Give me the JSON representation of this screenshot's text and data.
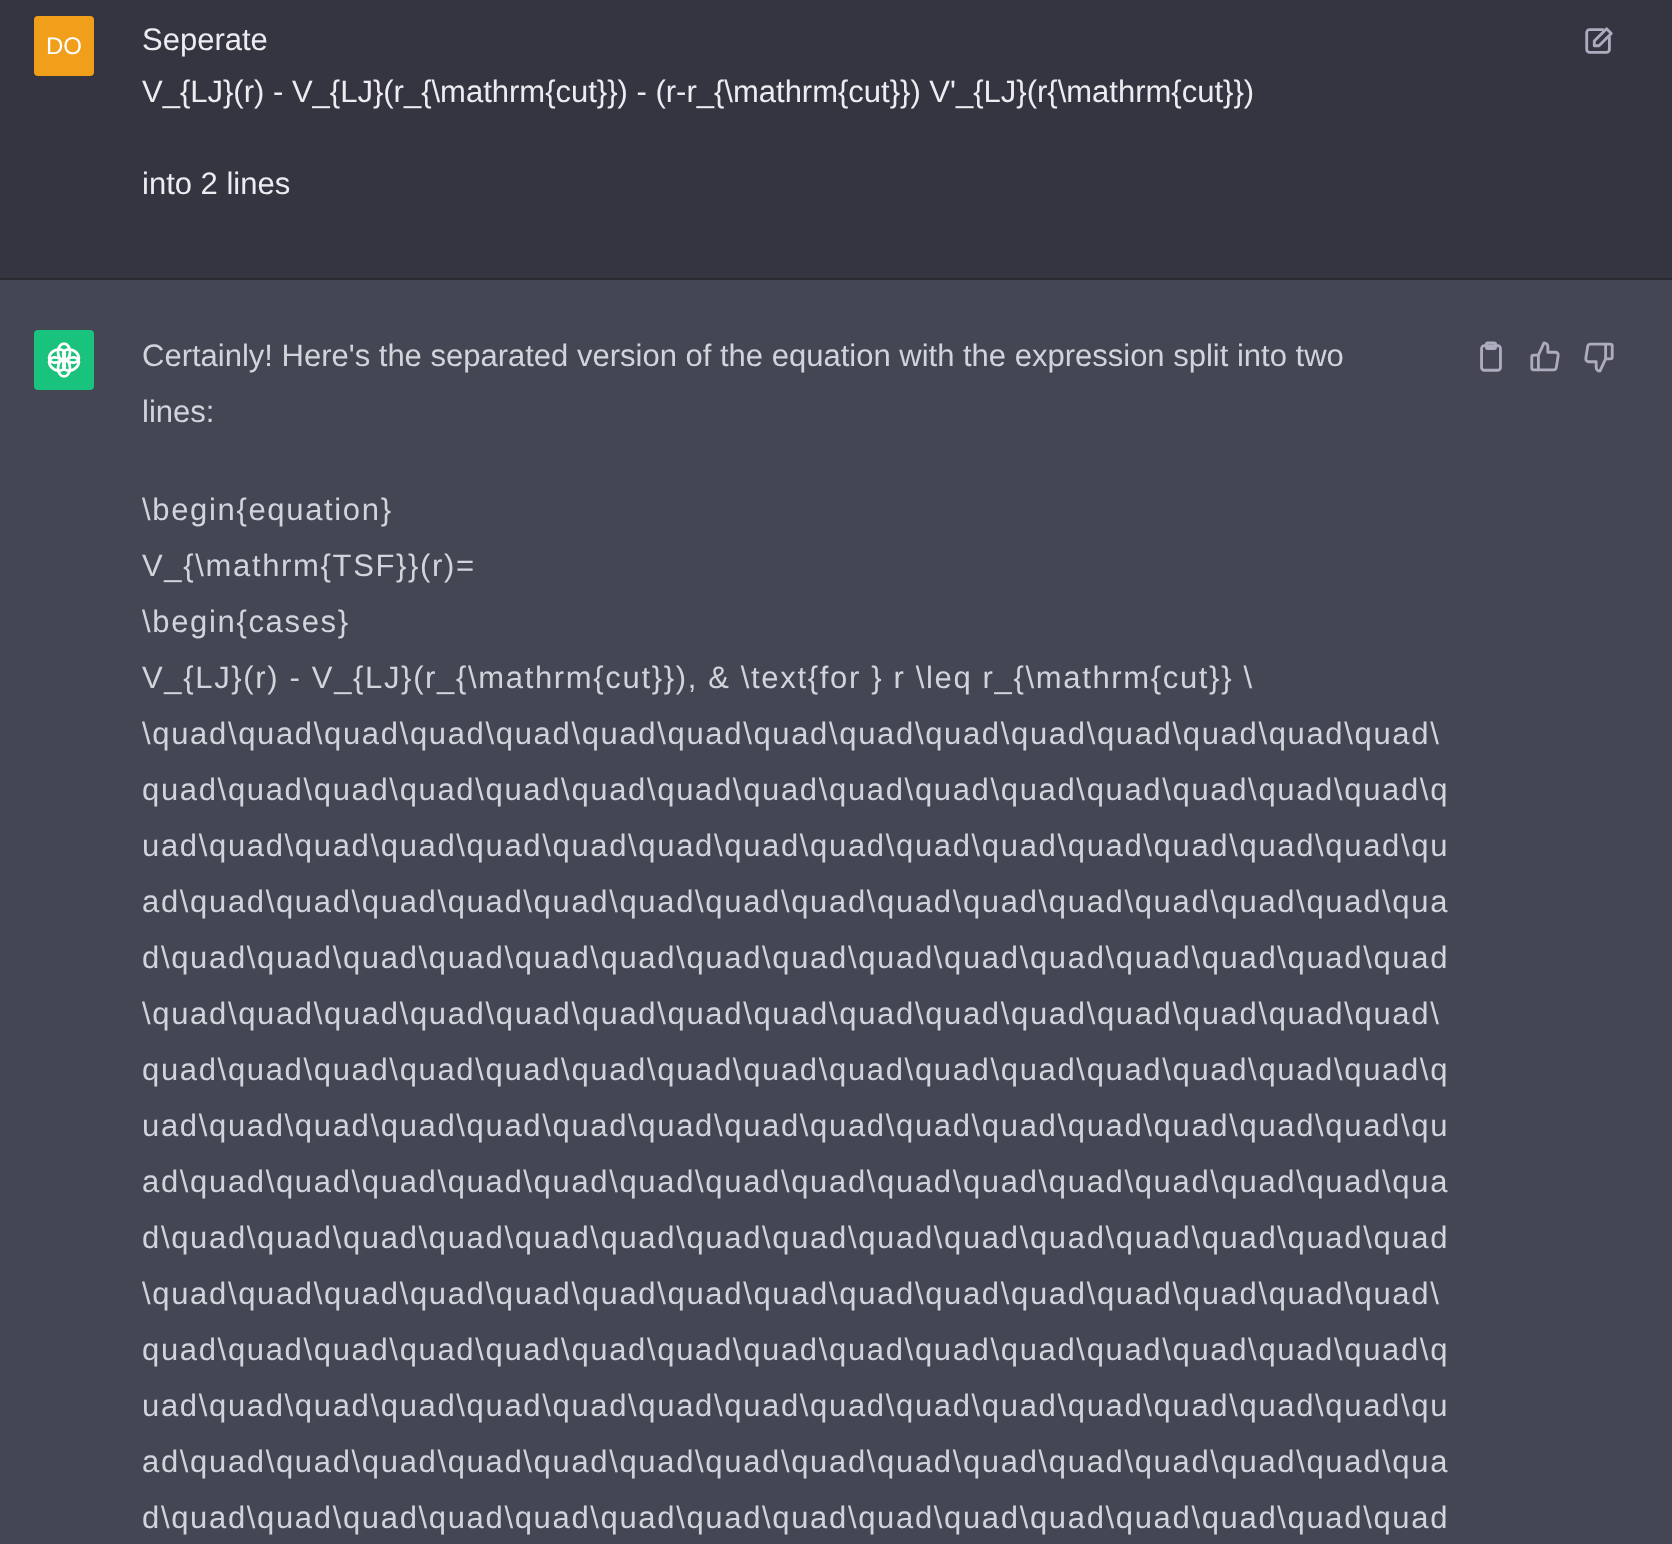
{
  "messages": [
    {
      "kind": "user",
      "avatar": "DO",
      "paragraphs": [
        [
          "Seperate",
          "V_{LJ}(r) - V_{LJ}(r_{\\mathrm{cut}}) - (r-r_{\\mathrm{cut}}) V'_{LJ}(r{\\mathrm{cut}})"
        ],
        [
          "into 2 lines"
        ]
      ],
      "actions": [
        {
          "kind": "edit"
        }
      ]
    },
    {
      "kind": "assistant",
      "paragraphs": [
        [
          "Certainly! Here's the separated version of the equation with the expression split into two lines:"
        ],
        [
          "\\begin{equation}",
          "V_{\\mathrm{TSF}}(r)=",
          "\\begin{cases}",
          "V_{LJ}(r) - V_{LJ}(r_{\\mathrm{cut}}), & \\text{for } r \\leq r_{\\mathrm{cut}} \\",
          "\\quad\\quad\\quad\\quad\\quad\\quad\\quad\\quad\\quad\\quad\\quad\\quad\\quad\\quad\\quad\\",
          "quad\\quad\\quad\\quad\\quad\\quad\\quad\\quad\\quad\\quad\\quad\\quad\\quad\\quad\\quad\\q",
          "uad\\quad\\quad\\quad\\quad\\quad\\quad\\quad\\quad\\quad\\quad\\quad\\quad\\quad\\quad\\qu",
          "ad\\quad\\quad\\quad\\quad\\quad\\quad\\quad\\quad\\quad\\quad\\quad\\quad\\quad\\quad\\qua",
          "d\\quad\\quad\\quad\\quad\\quad\\quad\\quad\\quad\\quad\\quad\\quad\\quad\\quad\\quad\\quad",
          "\\quad\\quad\\quad\\quad\\quad\\quad\\quad\\quad\\quad\\quad\\quad\\quad\\quad\\quad\\quad\\",
          "quad\\quad\\quad\\quad\\quad\\quad\\quad\\quad\\quad\\quad\\quad\\quad\\quad\\quad\\quad\\q",
          "uad\\quad\\quad\\quad\\quad\\quad\\quad\\quad\\quad\\quad\\quad\\quad\\quad\\quad\\quad\\qu",
          "ad\\quad\\quad\\quad\\quad\\quad\\quad\\quad\\quad\\quad\\quad\\quad\\quad\\quad\\quad\\qua",
          "d\\quad\\quad\\quad\\quad\\quad\\quad\\quad\\quad\\quad\\quad\\quad\\quad\\quad\\quad\\quad",
          "\\quad\\quad\\quad\\quad\\quad\\quad\\quad\\quad\\quad\\quad\\quad\\quad\\quad\\quad\\quad\\",
          "quad\\quad\\quad\\quad\\quad\\quad\\quad\\quad\\quad\\quad\\quad\\quad\\quad\\quad\\quad\\q",
          "uad\\quad\\quad\\quad\\quad\\quad\\quad\\quad\\quad\\quad\\quad\\quad\\quad\\quad\\quad\\qu",
          "ad\\quad\\quad\\quad\\quad\\quad\\quad\\quad\\quad\\quad\\quad\\quad\\quad\\quad\\quad\\qua",
          "d\\quad\\quad\\quad\\quad\\quad\\quad\\quad\\quad\\quad\\quad\\quad\\quad\\quad\\quad\\quad"
        ]
      ],
      "actions": [
        {
          "kind": "copy"
        },
        {
          "kind": "thumbs-up"
        },
        {
          "kind": "thumbs-down"
        }
      ]
    }
  ]
}
